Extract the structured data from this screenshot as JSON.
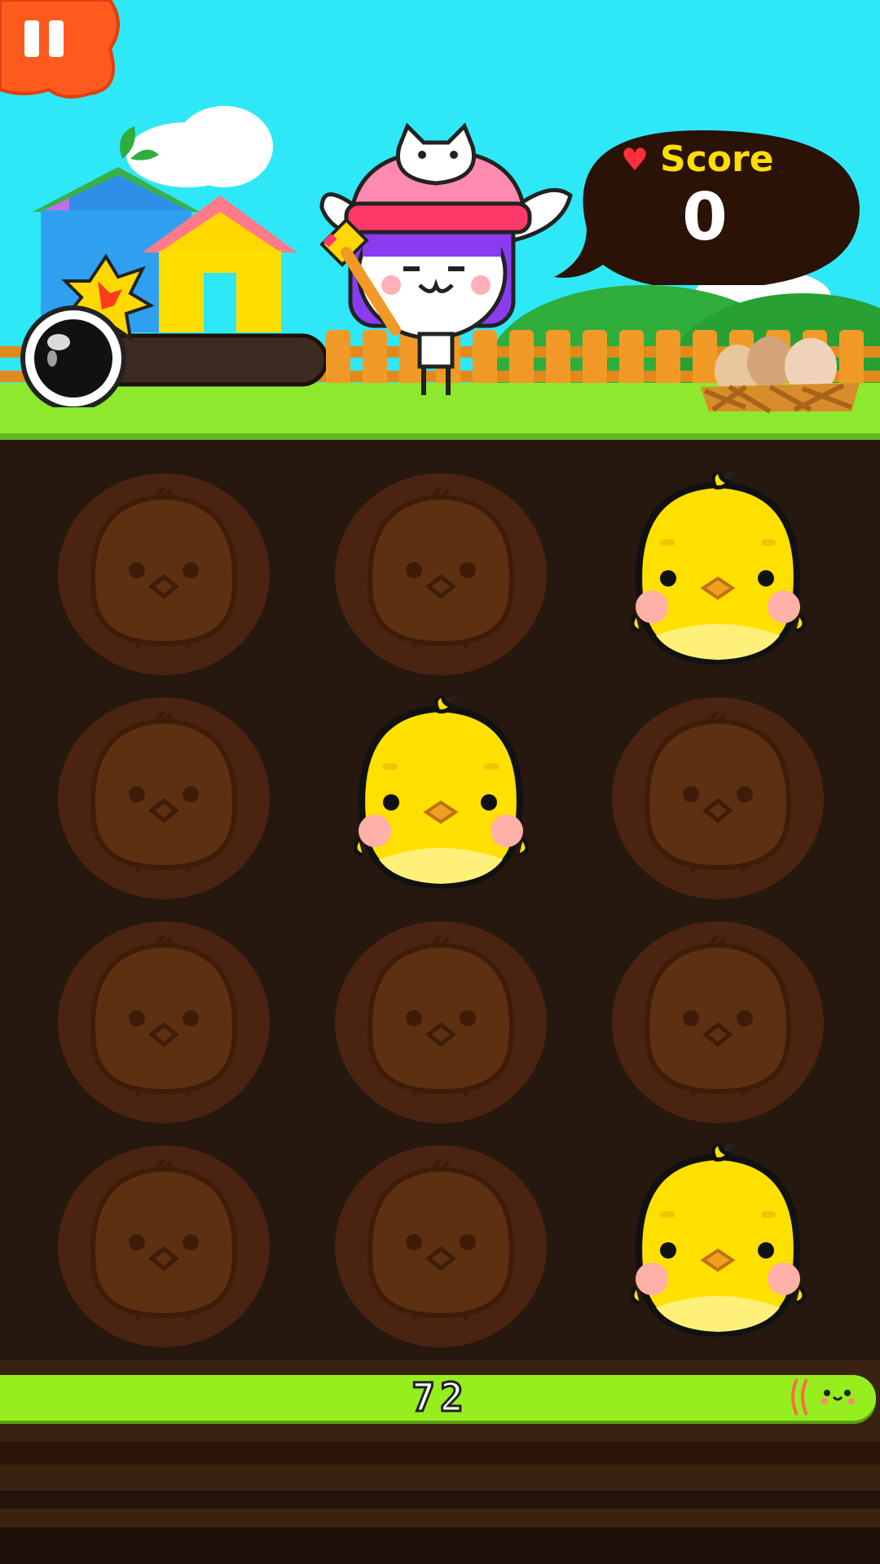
{
  "hud": {
    "score_label": "Score",
    "score_value": "0",
    "timer_value": "72",
    "bomb_gauge_fill": 0.0
  },
  "board": {
    "rows": 4,
    "cols": 3,
    "cells": [
      {
        "state": "empty"
      },
      {
        "state": "empty"
      },
      {
        "state": "chick"
      },
      {
        "state": "empty"
      },
      {
        "state": "chick"
      },
      {
        "state": "empty"
      },
      {
        "state": "empty"
      },
      {
        "state": "empty"
      },
      {
        "state": "empty"
      },
      {
        "state": "empty"
      },
      {
        "state": "empty"
      },
      {
        "state": "chick"
      }
    ]
  },
  "colors": {
    "sky": "#2ee8f8",
    "grass": "#8ee82e",
    "soil": "#26180e",
    "hole": "#5a2f10",
    "chick": "#ffe000",
    "timebar": "#96ee1e",
    "score_bubble": "#2a1206",
    "score_text": "#ffde00",
    "pause_button": "#ff5a1e"
  },
  "icons": [
    "pause-icon",
    "bomb-icon",
    "heart-icon",
    "chick-icon",
    "egg-nest-icon",
    "cat-character-icon",
    "hammer-icon",
    "timer-end-icon"
  ]
}
